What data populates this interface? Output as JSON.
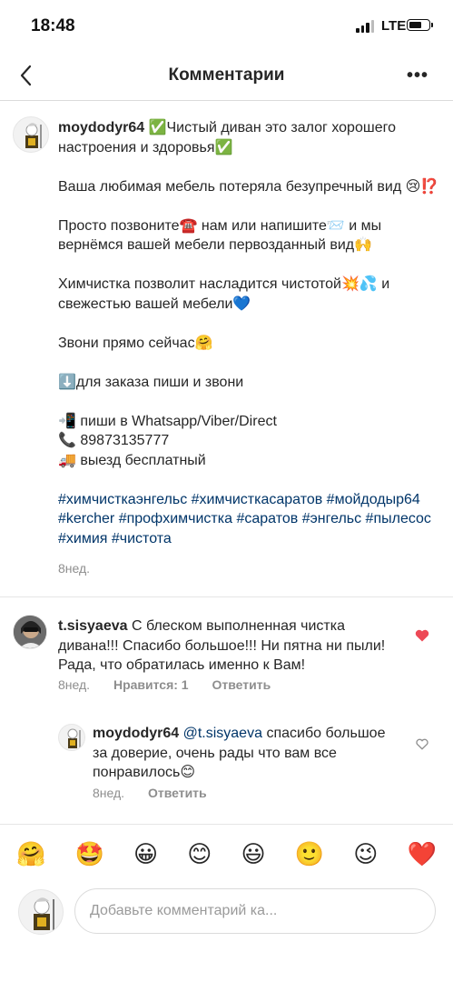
{
  "status_bar": {
    "time": "18:48",
    "network": "LTE"
  },
  "nav": {
    "title": "Комментарии",
    "more": "•••"
  },
  "post": {
    "username": "moydodyr64",
    "lines": [
      "✅Чистый диван это залог хорошего настроения и здоровья✅",
      "",
      "Ваша любимая мебель потеряла безупречный вид 😢⁉️",
      "",
      "Просто позвоните☎️ нам или напишите📨 и мы вернёмся вашей мебели первозданный вид🙌",
      "",
      "Химчистка позволит насладится чистотой💥💦 и свежестью вашей мебели💙",
      "",
      "Звони прямо сейчас🤗",
      "",
      "⬇️для заказа пиши и звони",
      "",
      "📲 пиши в Whatsapp/Viber/Direct",
      "📞 89873135777",
      "🚚 выезд бесплатный",
      ""
    ],
    "hashtags": "#химчисткаэнгельс #химчисткасаратов #мойдодыр64 #kercher #профхимчистка #саратов #энгельс #пылесос #химия #чистота",
    "time": "8нед."
  },
  "comment1": {
    "username": "t.sisyaeva",
    "text": "С блеском выполненная чистка дивана!!! Спасибо большое!!! Ни пятна ни пыли! Рада, что обратилась именно к Вам!",
    "time": "8нед.",
    "likes": "Нравится: 1",
    "reply": "Ответить"
  },
  "comment2": {
    "username": "moydodyr64",
    "mention": "@t.sisyaeva",
    "text": "спасибо большое за доверие, очень рады что вам все понравилось😊",
    "time": "8нед.",
    "reply": "Ответить"
  },
  "emoji_bar": [
    "🤗",
    "🤩",
    "😀",
    "😊",
    "😃",
    "🙂",
    "😉",
    "❤️"
  ],
  "input": {
    "placeholder": "Добавьте комментарий ка..."
  }
}
